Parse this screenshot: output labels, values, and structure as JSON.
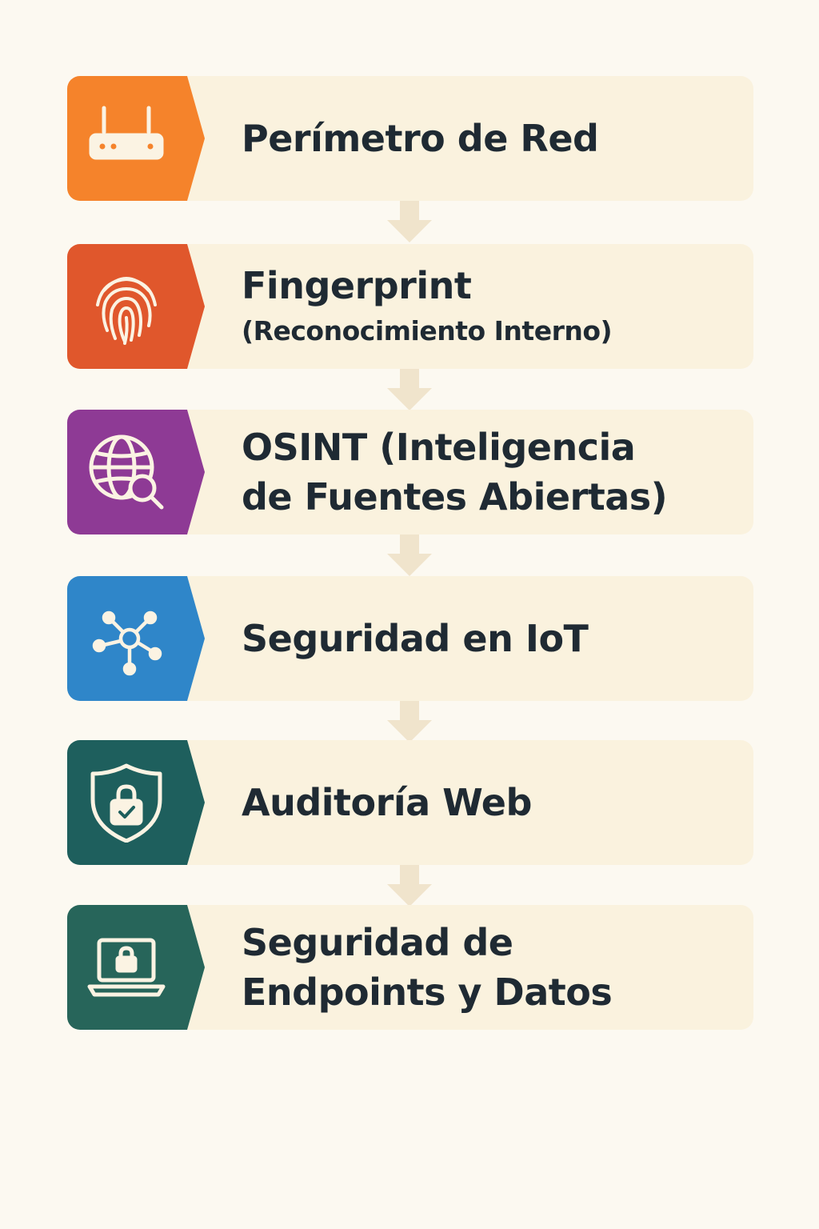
{
  "steps": [
    {
      "title": "Perímetro de Red",
      "subtitle": "",
      "icon": "router-icon",
      "color": "#f5832b"
    },
    {
      "title": "Fingerprint",
      "subtitle": "(Reconocimiento Interno)",
      "icon": "fingerprint-icon",
      "color": "#e0572c"
    },
    {
      "title": "OSINT (Inteligencia",
      "subtitle": "de Fuentes Abiertas)",
      "icon": "globe-search-icon",
      "color": "#8e3a95"
    },
    {
      "title": "Seguridad en IoT",
      "subtitle": "",
      "icon": "network-hub-icon",
      "color": "#2f86c9"
    },
    {
      "title": "Auditoría Web",
      "subtitle": "",
      "icon": "shield-lock-icon",
      "color": "#1e5f5d"
    },
    {
      "title": "Seguridad de",
      "subtitle": "Endpoints y Datos",
      "icon": "laptop-lock-icon",
      "color": "#27655a"
    }
  ],
  "colors": {
    "background": "#fcf9f1",
    "card": "#faf2de",
    "text": "#1f2a33",
    "connector": "#f0e4cc",
    "icon_stroke": "#fbf3e3"
  }
}
